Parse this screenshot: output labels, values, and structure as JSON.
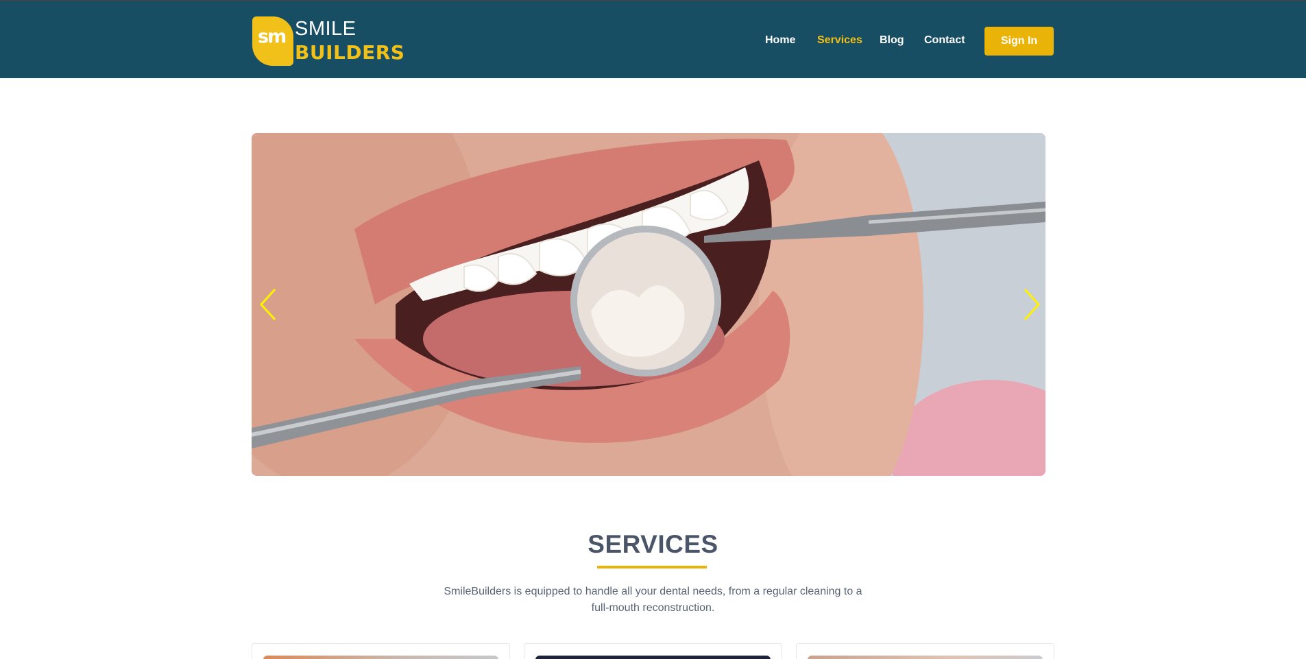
{
  "logo": {
    "mark": "sm",
    "line1": "SMILE",
    "line2": "BUILDERS"
  },
  "nav": {
    "items": [
      {
        "label": "Home",
        "active": false
      },
      {
        "label": "Services",
        "active": true
      },
      {
        "label": "Blog",
        "active": false
      },
      {
        "label": "Contact",
        "active": false
      }
    ],
    "signin_label": "Sign In"
  },
  "hero": {
    "image": "dental-mirror-smile-photo",
    "prev_icon": "chevron-left-icon",
    "next_icon": "chevron-right-icon"
  },
  "services": {
    "title": "SERVICES",
    "description_line1": "SmileBuilders is equipped to handle all your dental needs, from a regular cleaning to a",
    "description_line2": "full-mouth reconstruction."
  },
  "colors": {
    "header_bg": "#174e63",
    "accent": "#eab308",
    "text": "#4a5568"
  }
}
